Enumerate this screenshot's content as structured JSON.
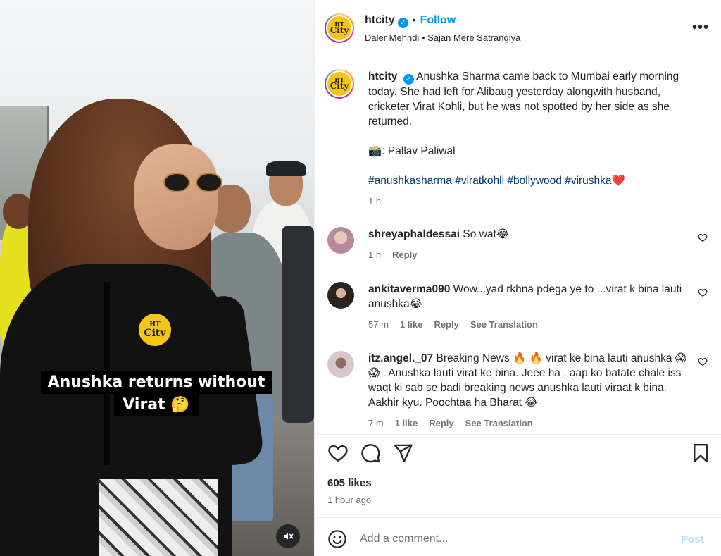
{
  "media": {
    "overlay_line1": "Anushka returns without",
    "overlay_line2": "Virat 🤔",
    "logo_ht": "HT",
    "logo_city": "City",
    "mute_icon": "speaker-muted-icon"
  },
  "header": {
    "username": "htcity",
    "verified_mark": "✓",
    "separator": "•",
    "follow_label": "Follow",
    "audio": "Daler Mehndi • Sajan Mere Satrangiya",
    "more_label": "•••",
    "avatar_ht": "HT",
    "avatar_city": "City"
  },
  "caption": {
    "username": "htcity",
    "text": "Anushka Sharma came back to Mumbai early morning today. She had left for Alibaug yesterday alongwith husband, cricketer Virat Kohli, but he was not spotted by her side as she returned.",
    "credit": "📸: Pallav Paliwal",
    "hashtags": [
      "#anushkasharma",
      "#viratkohli",
      "#bollywood",
      "#virushka"
    ],
    "heart": "❤️",
    "time": "1 h"
  },
  "comments": [
    {
      "username": "shreyaphaldessai",
      "text": "So wat😂",
      "time": "1 h",
      "likes": "",
      "reply": "Reply",
      "translation": "",
      "avatar_color": "#b48a9c"
    },
    {
      "username": "ankitaverma090",
      "text": "Wow...yad rkhna pdega ye to ...virat k bina lauti anushka😂",
      "time": "57 m",
      "likes": "1 like",
      "reply": "Reply",
      "translation": "See Translation",
      "avatar_color": "#3a3230"
    },
    {
      "username": "itz.angel._07",
      "text": "Breaking News 🔥 🔥 virat ke bina lauti anushka 😱 😱 . Anushka lauti virat ke bina. Jeee ha , aap ko batate chale iss waqt ki sab se badi breaking news anushka lauti viraat k bina. Aakhir kyu. Poochtaa ha Bharat 😂",
      "time": "7 m",
      "likes": "1 like",
      "reply": "Reply",
      "translation": "See Translation",
      "avatar_color": "#d8c6c9"
    }
  ],
  "actions": {
    "like_icon": "heart-outline-icon",
    "comment_icon": "comment-bubble-icon",
    "share_icon": "paper-plane-icon",
    "save_icon": "bookmark-icon"
  },
  "likes": "605 likes",
  "posted_ago": "1 hour ago",
  "comment_box": {
    "emoji_icon": "smiley-icon",
    "placeholder": "Add a comment...",
    "post_label": "Post"
  },
  "colors": {
    "link_blue": "#0095f6",
    "hashtag_blue": "#00376b",
    "muted_text": "#737373",
    "post_disabled": "#b2dffc",
    "htcity_yellow": "#f5c518"
  }
}
